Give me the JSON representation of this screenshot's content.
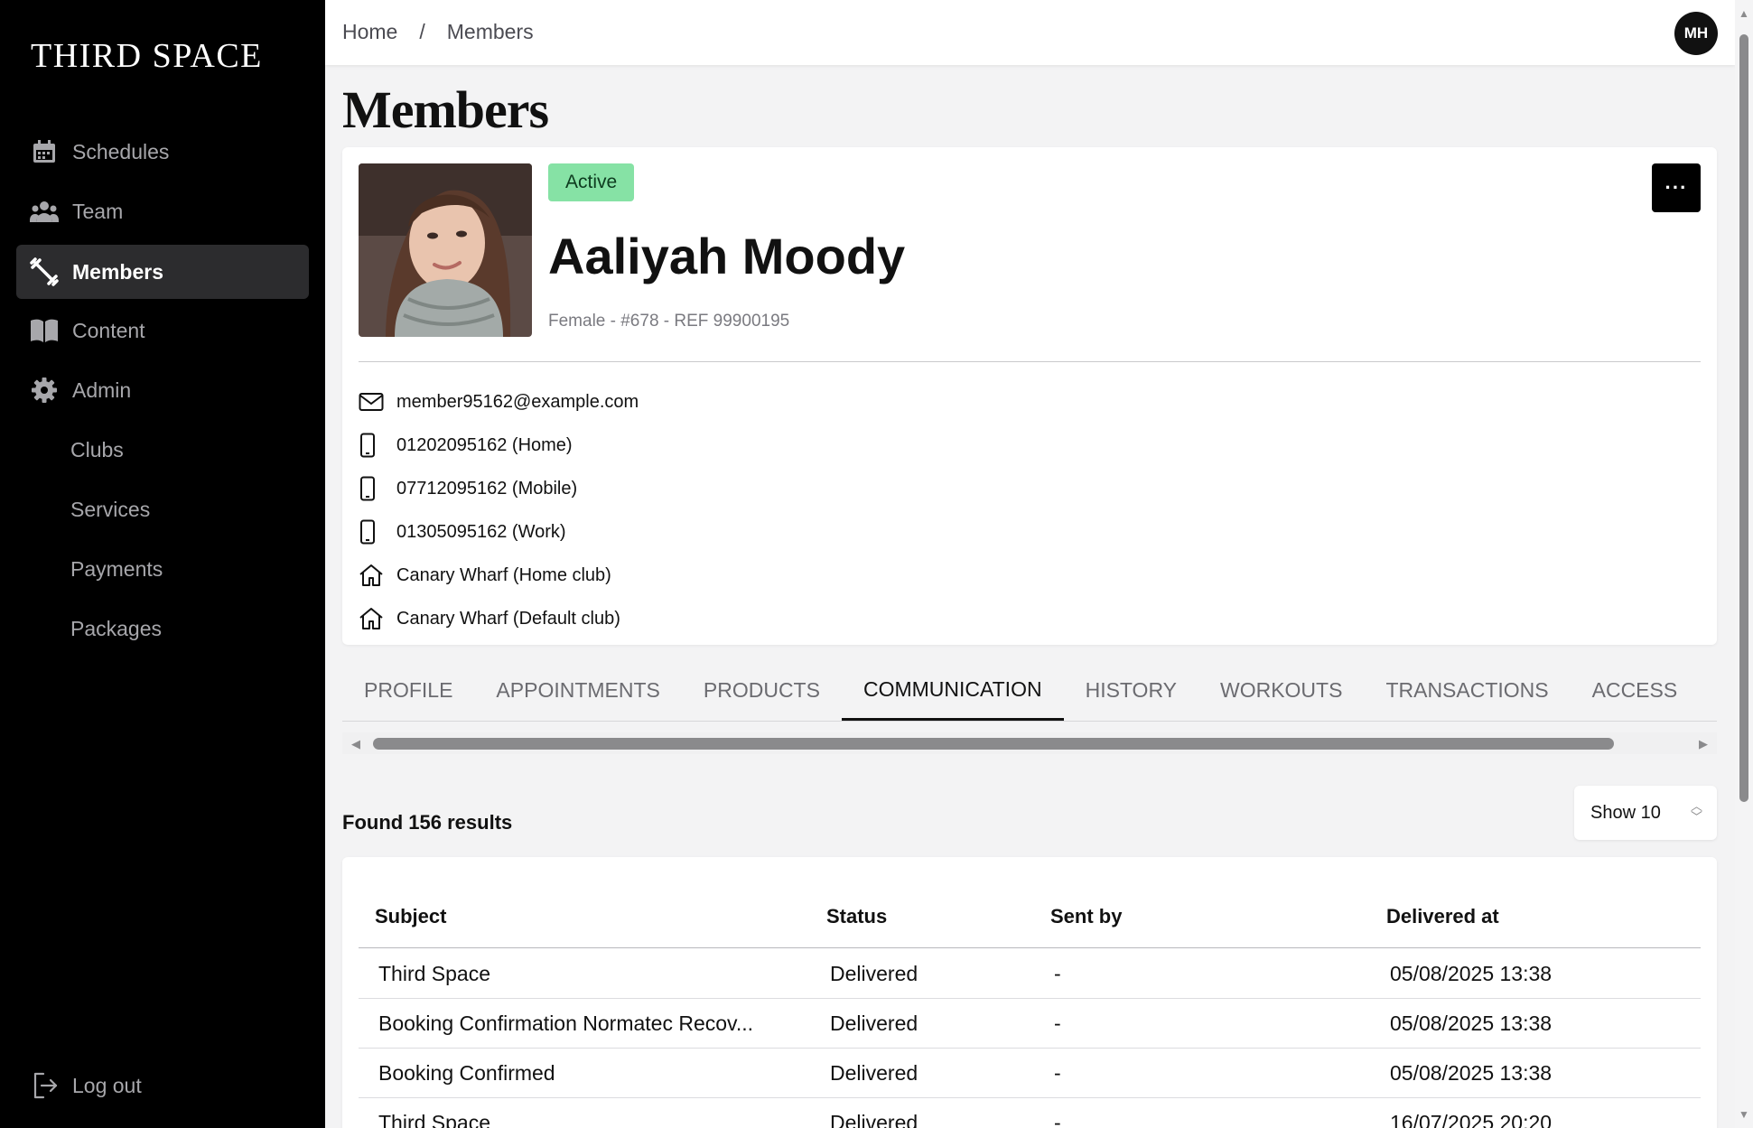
{
  "brand": {
    "name": "THIRD SPACE"
  },
  "sidebar": {
    "items": [
      {
        "label": "Schedules",
        "icon": "calendar-icon"
      },
      {
        "label": "Team",
        "icon": "team-icon"
      },
      {
        "label": "Members",
        "icon": "dumbbell-icon",
        "active": true
      },
      {
        "label": "Content",
        "icon": "book-icon"
      },
      {
        "label": "Admin",
        "icon": "gear-icon"
      }
    ],
    "subitems": [
      {
        "label": "Clubs"
      },
      {
        "label": "Services"
      },
      {
        "label": "Payments"
      },
      {
        "label": "Packages"
      }
    ],
    "logout": {
      "label": "Log out",
      "icon": "logout-icon"
    }
  },
  "header": {
    "breadcrumb": {
      "home": "Home",
      "separator": "/",
      "current": "Members"
    },
    "avatar_initials": "MH"
  },
  "page": {
    "title": "Members"
  },
  "member": {
    "status": "Active",
    "status_color": "#86e2a5",
    "name": "Aaliyah Moody",
    "meta": "Female - #678 - REF 99900195",
    "more_label": "···",
    "contacts": [
      {
        "icon": "mail-icon",
        "text": "member95162@example.com"
      },
      {
        "icon": "phone-icon",
        "text": "01202095162 (Home)"
      },
      {
        "icon": "phone-icon",
        "text": "07712095162 (Mobile)"
      },
      {
        "icon": "phone-icon",
        "text": "01305095162 (Work)"
      },
      {
        "icon": "home-icon",
        "text": "Canary Wharf (Home club)"
      },
      {
        "icon": "home-icon",
        "text": "Canary Wharf (Default club)"
      }
    ]
  },
  "tabs": [
    {
      "label": "PROFILE"
    },
    {
      "label": "APPOINTMENTS"
    },
    {
      "label": "PRODUCTS"
    },
    {
      "label": "COMMUNICATION",
      "active": true
    },
    {
      "label": "HISTORY"
    },
    {
      "label": "WORKOUTS"
    },
    {
      "label": "TRANSACTIONS"
    },
    {
      "label": "ACCESS"
    }
  ],
  "results": {
    "count_text": "Found 156 results",
    "show_label": "Show 10"
  },
  "table": {
    "headers": {
      "subject": "Subject",
      "status": "Status",
      "sent_by": "Sent by",
      "delivered_at": "Delivered at"
    },
    "rows": [
      {
        "subject": "Third Space",
        "status": "Delivered",
        "sent_by": "-",
        "delivered_at": "05/08/2025 13:38"
      },
      {
        "subject": "Booking Confirmation Normatec Recov...",
        "status": "Delivered",
        "sent_by": "-",
        "delivered_at": "05/08/2025 13:38"
      },
      {
        "subject": "Booking Confirmed",
        "status": "Delivered",
        "sent_by": "-",
        "delivered_at": "05/08/2025 13:38"
      },
      {
        "subject": "Third Space",
        "status": "Delivered",
        "sent_by": "-",
        "delivered_at": "16/07/2025 20:20"
      }
    ]
  }
}
